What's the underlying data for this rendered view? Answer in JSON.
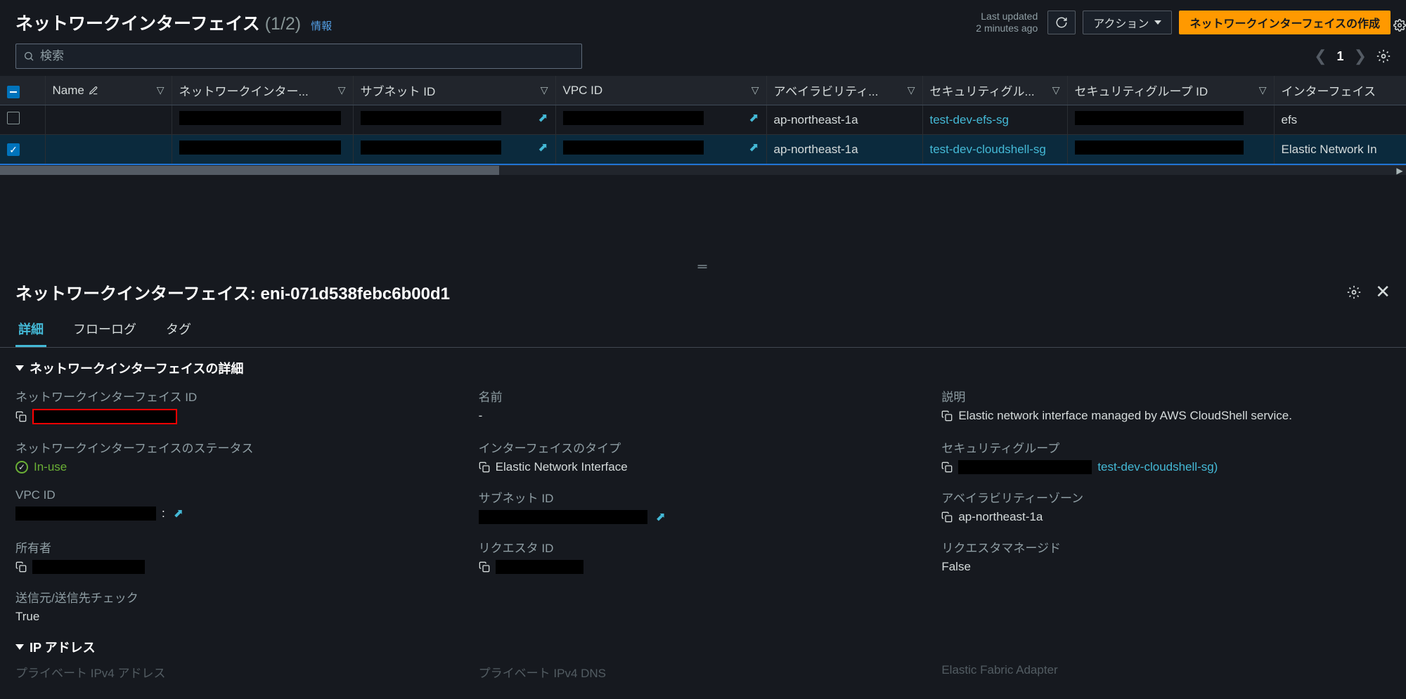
{
  "header": {
    "title": "ネットワークインターフェイス",
    "count": "(1/2)",
    "info": "情報",
    "lastUpdated_line1": "Last updated",
    "lastUpdated_line2": "2 minutes ago",
    "actions": "アクション",
    "create": "ネットワークインターフェイスの作成"
  },
  "search": {
    "placeholder": "検索"
  },
  "pager": {
    "page": "1"
  },
  "columns": {
    "name": "Name",
    "eni": "ネットワークインター...",
    "subnet": "サブネット ID",
    "vpc": "VPC ID",
    "az": "アベイラビリティ...",
    "sgName": "セキュリティグル...",
    "sgId": "セキュリティグループ ID",
    "ifType": "インターフェイス"
  },
  "rows": [
    {
      "selected": false,
      "az": "ap-northeast-1a",
      "sgName": "test-dev-efs-sg",
      "ifType": "efs"
    },
    {
      "selected": true,
      "az": "ap-northeast-1a",
      "sgName": "test-dev-cloudshell-sg",
      "ifType": "Elastic Network In"
    }
  ],
  "detail": {
    "title_prefix": "ネットワークインターフェイス: ",
    "eniId": "eni-071d538febc6b00d1",
    "tabs": {
      "detail": "詳細",
      "flowlog": "フローログ",
      "tags": "タグ"
    },
    "section1": "ネットワークインターフェイスの詳細",
    "section2": "IP アドレス",
    "fields": {
      "eniId_label": "ネットワークインターフェイス ID",
      "name_label": "名前",
      "name_value": "-",
      "desc_label": "説明",
      "desc_value": "Elastic network interface managed by AWS CloudShell service.",
      "status_label": "ネットワークインターフェイスのステータス",
      "status_value": "In-use",
      "ifType_label": "インターフェイスのタイプ",
      "ifType_value": "Elastic Network Interface",
      "sg_label": "セキュリティグループ",
      "sg_value_suffix": "test-dev-cloudshell-sg)",
      "vpc_label": "VPC ID",
      "subnet_label": "サブネット ID",
      "az_label": "アベイラビリティーゾーン",
      "az_value": "ap-northeast-1a",
      "owner_label": "所有者",
      "requester_label": "リクエスタ ID",
      "reqManaged_label": "リクエスタマネージド",
      "reqManaged_value": "False",
      "srcdst_label": "送信元/送信先チェック",
      "srcdst_value": "True",
      "priv4_label": "プライベート IPv4 アドレス",
      "priv4dns_label": "プライベート IPv4 DNS",
      "efa_label": "Elastic Fabric Adapter"
    }
  }
}
